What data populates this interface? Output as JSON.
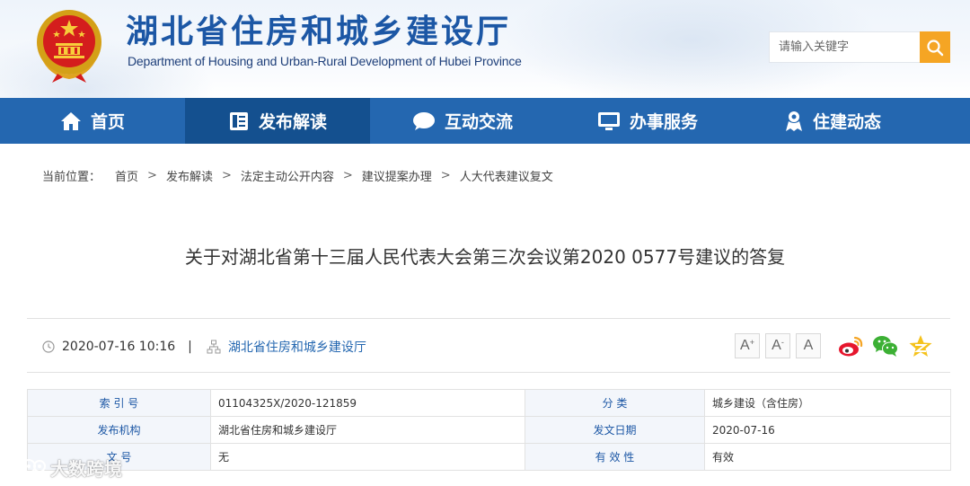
{
  "site": {
    "title": "湖北省住房和城乡建设厅",
    "subtitle": "Department of Housing and Urban-Rural Development of Hubei Province"
  },
  "search": {
    "placeholder": "请输入关键字"
  },
  "nav": [
    {
      "label": "首页",
      "icon": "home-icon"
    },
    {
      "label": "发布解读",
      "icon": "document-icon",
      "active": true
    },
    {
      "label": "互动交流",
      "icon": "chat-bubble-icon"
    },
    {
      "label": "办事服务",
      "icon": "monitor-icon"
    },
    {
      "label": "住建动态",
      "icon": "person-badge-icon"
    }
  ],
  "breadcrumb": {
    "prefix": "当前位置：",
    "items": [
      "首页",
      "发布解读",
      "法定主动公开内容",
      "建议提案办理",
      "人大代表建议复文"
    ]
  },
  "article": {
    "title": "关于对湖北省第十三届人民代表大会第三次会议第2020 0577号建议的答复",
    "datetime": "2020-07-16 10:16",
    "separator": "|",
    "org": "湖北省住房和城乡建设厅"
  },
  "font_size_buttons": [
    {
      "label": "A",
      "mark": "+"
    },
    {
      "label": "A",
      "mark": "-"
    },
    {
      "label": "A",
      "mark": ""
    }
  ],
  "info_table": {
    "rows": [
      [
        "索 引 号",
        "01104325X/2020-121859",
        "分 类",
        "城乡建设（含住房）"
      ],
      [
        "发布机构",
        "湖北省住房和城乡建设厅",
        "发文日期",
        "2020-07-16"
      ],
      [
        "文 号",
        "无",
        "有 效 性",
        "有效"
      ]
    ]
  },
  "watermark": {
    "text": "大数跨境"
  },
  "colors": {
    "brand_blue": "#2467b0",
    "nav_active": "#14508f",
    "search_orange": "#f5a524",
    "label_blue": "#1c57a5"
  }
}
